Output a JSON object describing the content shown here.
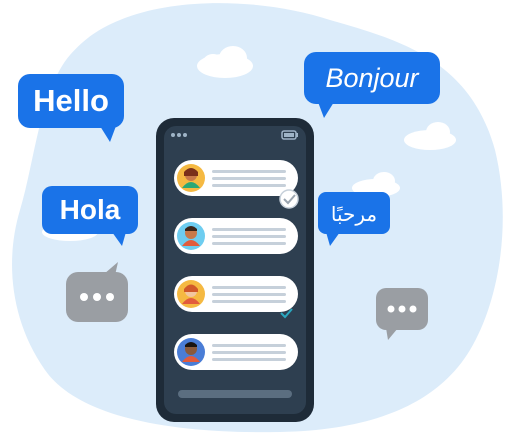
{
  "bubbles": {
    "hello": "Hello",
    "bonjour": "Bonjour",
    "hola": "Hola",
    "marhaba": "مرحبًا"
  },
  "colors": {
    "blob": "#dcecfa",
    "bubble_blue": "#1a73e8",
    "phone_body": "#1e2b38",
    "phone_screen": "#2e3f50",
    "message_card": "#ffffff",
    "typing_bubble": "#9a9ea3",
    "cloud": "#ffffff"
  },
  "icons": [
    "signal-icon",
    "battery-icon",
    "check-icon",
    "double-check-icon",
    "typing-dots-icon",
    "avatar-icon"
  ],
  "chat": {
    "message_count": 4,
    "read_markers": [
      true,
      false,
      true,
      false
    ]
  }
}
